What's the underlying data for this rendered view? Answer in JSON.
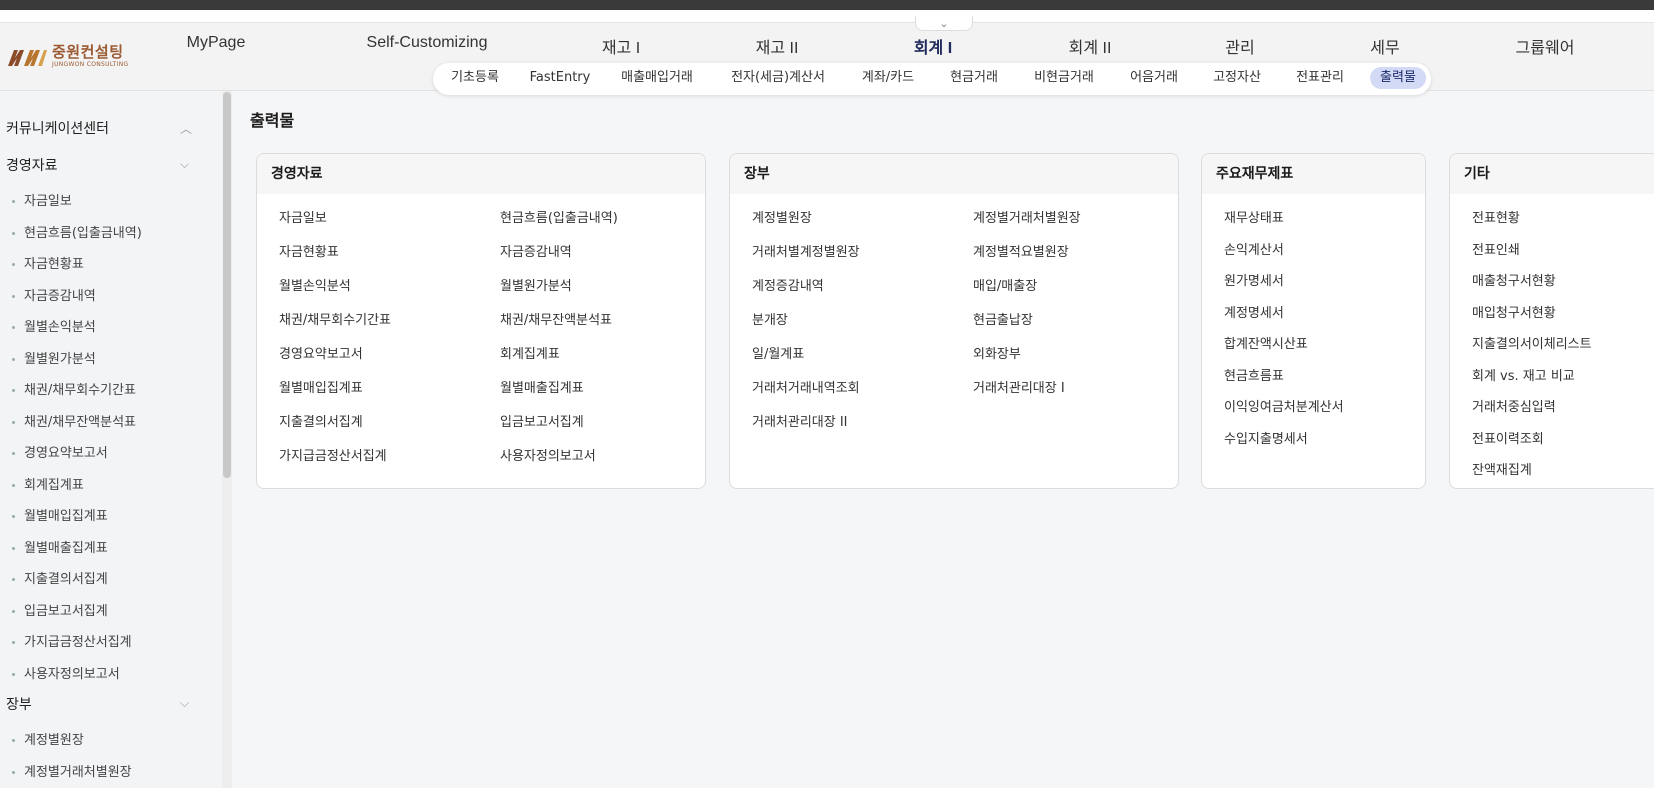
{
  "logo": {
    "name_kr": "중원컨설팅",
    "name_en": "JUNGWON CONSULTING"
  },
  "top_menu": [
    "MyPage",
    "Self-Customizing",
    "재고 I",
    "재고 II",
    "회계 I",
    "회계 II",
    "관리",
    "세무",
    "그룹웨어"
  ],
  "top_menu_active": "회계 I",
  "sub_menu": [
    "기초등록",
    "FastEntry",
    "매출매입거래",
    "전자(세금)계산서",
    "계좌/카드",
    "현금거래",
    "비현금거래",
    "어음거래",
    "고정자산",
    "전표관리",
    "출력물"
  ],
  "sub_menu_active": "출력물",
  "sidebar": {
    "groups": [
      {
        "label": "커뮤니케이션센터",
        "expanded": false,
        "items": []
      },
      {
        "label": "경영자료",
        "expanded": true,
        "items": [
          "자금일보",
          "현금흐름(입출금내역)",
          "자금현황표",
          "자금증감내역",
          "월별손익분석",
          "월별원가분석",
          "채권/채무회수기간표",
          "채권/채무잔액분석표",
          "경영요약보고서",
          "회계집계표",
          "월별매입집계표",
          "월별매출집계표",
          "지출결의서집계",
          "입금보고서집계",
          "가지급금정산서집계",
          "사용자정의보고서"
        ]
      },
      {
        "label": "장부",
        "expanded": true,
        "items": [
          "계정별원장",
          "계정별거래처별원장"
        ]
      }
    ]
  },
  "page_title": "출력물",
  "cards": [
    {
      "title": "경영자료",
      "links": [
        "자금일보",
        "현금흐름(입출금내역)",
        "자금현황표",
        "자금증감내역",
        "월별손익분석",
        "월별원가분석",
        "채권/채무회수기간표",
        "채권/채무잔액분석표",
        "경영요약보고서",
        "회계집계표",
        "월별매입집계표",
        "월별매출집계표",
        "지출결의서집계",
        "입금보고서집계",
        "가지급금정산서집계",
        "사용자정의보고서"
      ]
    },
    {
      "title": "장부",
      "links": [
        "계정별원장",
        "계정별거래처별원장",
        "거래처별계정별원장",
        "계정별적요별원장",
        "계정증감내역",
        "매입/매출장",
        "분개장",
        "현금출납장",
        "일/월계표",
        "외화장부",
        "거래처거래내역조회",
        "거래처관리대장 I",
        "거래처관리대장 II"
      ]
    },
    {
      "title": "주요재무제표",
      "links": [
        "재무상태표",
        "손익계산서",
        "원가명세서",
        "계정명세서",
        "합계잔액시산표",
        "현금흐름표",
        "이익잉여금처분계산서",
        "수입지출명세서"
      ]
    },
    {
      "title": "기타",
      "links": [
        "전표현황",
        "전표인쇄",
        "매출청구서현황",
        "매입청구서현황",
        "지출결의서이체리스트",
        "회계 vs. 재고 비교",
        "거래처중심입력",
        "전표이력조회",
        "잔액재집계"
      ]
    }
  ]
}
